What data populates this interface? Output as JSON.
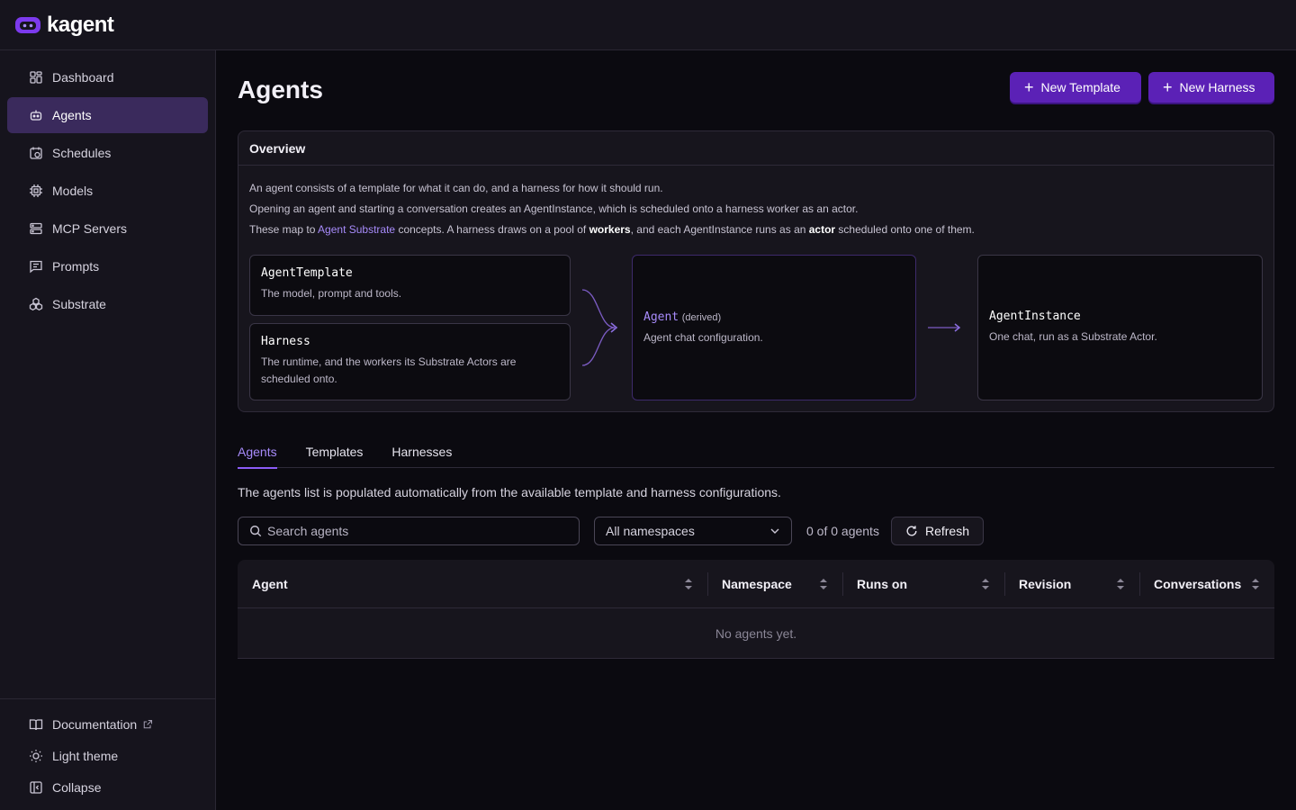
{
  "app": {
    "name": "kagent"
  },
  "sidebar": {
    "items": [
      {
        "label": "Dashboard",
        "icon": "dashboard-icon"
      },
      {
        "label": "Agents",
        "icon": "bot-icon",
        "active": true
      },
      {
        "label": "Schedules",
        "icon": "calendar-clock-icon"
      },
      {
        "label": "Models",
        "icon": "cpu-icon"
      },
      {
        "label": "MCP Servers",
        "icon": "server-icon"
      },
      {
        "label": "Prompts",
        "icon": "message-square-icon"
      },
      {
        "label": "Substrate",
        "icon": "boxes-icon"
      }
    ],
    "bottom": {
      "documentation": "Documentation",
      "theme": "Light theme",
      "collapse": "Collapse"
    }
  },
  "page": {
    "title": "Agents",
    "new_template": "New Template",
    "new_harness": "New Harness"
  },
  "overview": {
    "title": "Overview",
    "line1": "An agent consists of a template for what it can do, and a harness for how it should run.",
    "line2": "Opening an agent and starting a conversation creates an AgentInstance, which is scheduled onto a harness worker as an actor.",
    "line3_a": "These map to ",
    "line3_link": "Agent Substrate",
    "line3_b": " concepts. A harness draws on a pool of ",
    "line3_workers": "workers",
    "line3_c": ", and each AgentInstance runs as an ",
    "line3_actor": "actor",
    "line3_d": " scheduled onto one of them.",
    "template": {
      "title": "AgentTemplate",
      "desc": "The model, prompt and tools."
    },
    "harness": {
      "title": "Harness",
      "desc": "The runtime, and the workers its Substrate Actors are scheduled onto."
    },
    "agent": {
      "title": "Agent",
      "tag": "(derived)",
      "desc": "Agent chat configuration."
    },
    "instance": {
      "title": "AgentInstance",
      "desc": "One chat, run as a Substrate Actor."
    }
  },
  "tabs": [
    {
      "label": "Agents",
      "active": true
    },
    {
      "label": "Templates"
    },
    {
      "label": "Harnesses"
    }
  ],
  "list": {
    "description": "The agents list is populated automatically from the available template and harness configurations.",
    "search_placeholder": "Search agents",
    "namespace_selected": "All namespaces",
    "count": "0 of 0 agents",
    "refresh": "Refresh",
    "columns": [
      "Agent",
      "Namespace",
      "Runs on",
      "Revision",
      "Conversations"
    ],
    "empty": "No agents yet."
  },
  "colors": {
    "accent": "#5b21b6",
    "accent_light": "#a78bfa",
    "background": "#0b0a10",
    "panel": "#16141d"
  }
}
